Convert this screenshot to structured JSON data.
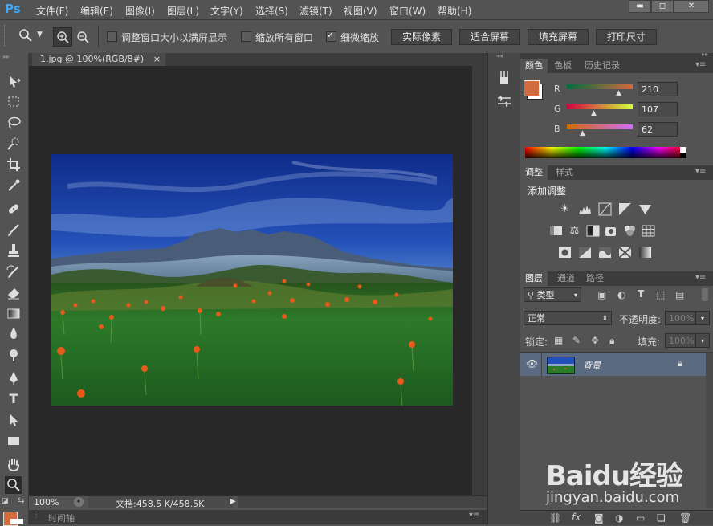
{
  "app": {
    "logo": "Ps"
  },
  "menu": [
    "文件(F)",
    "编辑(E)",
    "图像(I)",
    "图层(L)",
    "文字(Y)",
    "选择(S)",
    "滤镜(T)",
    "视图(V)",
    "窗口(W)",
    "帮助(H)"
  ],
  "window_controls": {
    "minimize": "▬",
    "maximize": "◻",
    "close": "✕"
  },
  "options": {
    "resize_window_label": "调整窗口大小以满屏显示",
    "zoom_all_label": "缩放所有窗口",
    "scrubby_zoom_label": "细微缩放",
    "scrubby_zoom_checked": true,
    "actual_pixels_label": "实际像素",
    "fit_screen_label": "适合屏幕",
    "fill_screen_label": "填充屏幕",
    "print_size_label": "打印尺寸"
  },
  "document": {
    "tab_title": "1.jpg @ 100%(RGB/8#)",
    "tab_close": "×"
  },
  "status": {
    "zoom": "100%",
    "doc_info": "文档:458.5 K/458.5K"
  },
  "timeline": {
    "label": "时间轴"
  },
  "color_panel": {
    "tabs": [
      "颜色",
      "色板",
      "历史记录"
    ],
    "r_label": "R",
    "g_label": "G",
    "b_label": "B",
    "r": "210",
    "g": "107",
    "b": "62",
    "foreground": "#d26b3e"
  },
  "adjust_panel": {
    "tabs": [
      "调整",
      "样式"
    ],
    "title": "添加调整"
  },
  "layers_panel": {
    "tabs": [
      "图层",
      "通道",
      "路径"
    ],
    "filter_label": "类型",
    "blend_mode": "正常",
    "opacity_label": "不透明度:",
    "opacity_value": "100%",
    "lock_label": "锁定:",
    "fill_label": "填充:",
    "fill_value": "100%",
    "layer_name": "背景"
  },
  "watermark": {
    "brand": "Baidu经验",
    "url": "jingyan.baidu.com"
  },
  "colors": {
    "ui_bg": "#535353",
    "canvas_bg": "#282828",
    "accent": "#3fa9f5",
    "selected_layer": "#5a6a80"
  }
}
